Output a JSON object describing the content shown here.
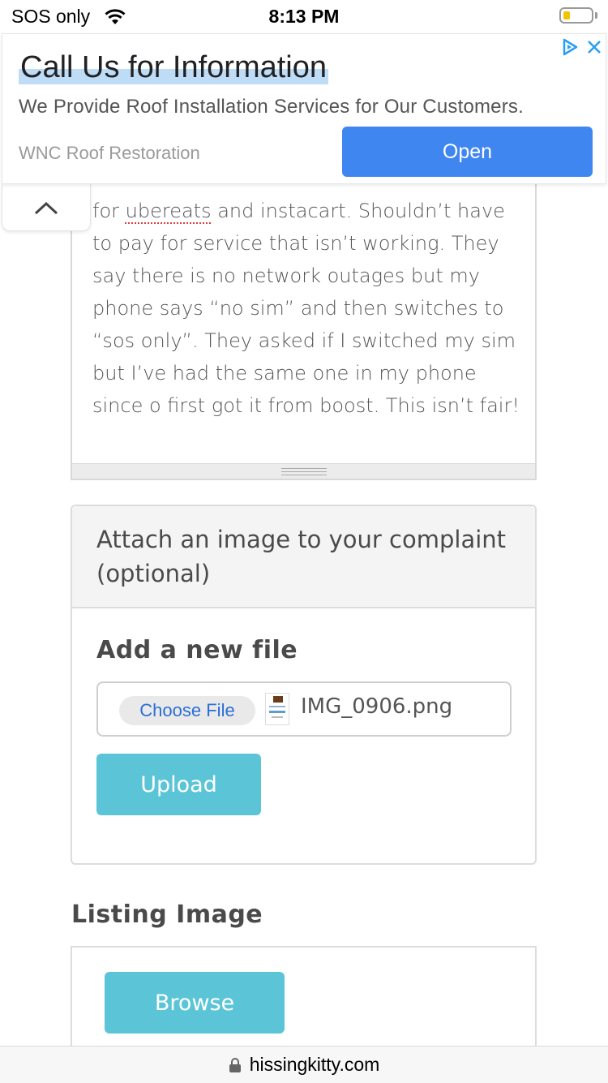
{
  "status_bar": {
    "carrier": "SOS only",
    "time": "8:13 PM",
    "battery_color": "#f3c300"
  },
  "ad": {
    "title": "Call Us for Information",
    "description": "We Provide Roof Installation Services for Our Customers.",
    "source": "WNC Roof Restoration",
    "open_label": "Open",
    "accent_color": "#3f86f0",
    "icons": [
      "ad-choices-icon",
      "close-icon"
    ]
  },
  "complaint": {
    "text_before": "for ",
    "misspelled": "ubereats",
    "text_after": " and instacart.  Shouldn’t have to pay for service that isn’t working. They say there is no network outages but my phone says “no sim” and then switches to “sos only”. They asked if I switched my sim but I’ve had the same one in my phone since o first got it from boost. This isn’t fair!"
  },
  "attach": {
    "title": "Attach an image to your complaint (optional)",
    "add_file_label": "Add a new file",
    "choose_file_label": "Choose File",
    "file_name": "IMG_0906.png",
    "upload_label": "Upload"
  },
  "listing": {
    "label": "Listing Image",
    "browse_label": "Browse"
  },
  "browser": {
    "url": "hissingkitty.com"
  },
  "colors": {
    "button": "#5bc5d7",
    "link": "#2a6fd6"
  }
}
